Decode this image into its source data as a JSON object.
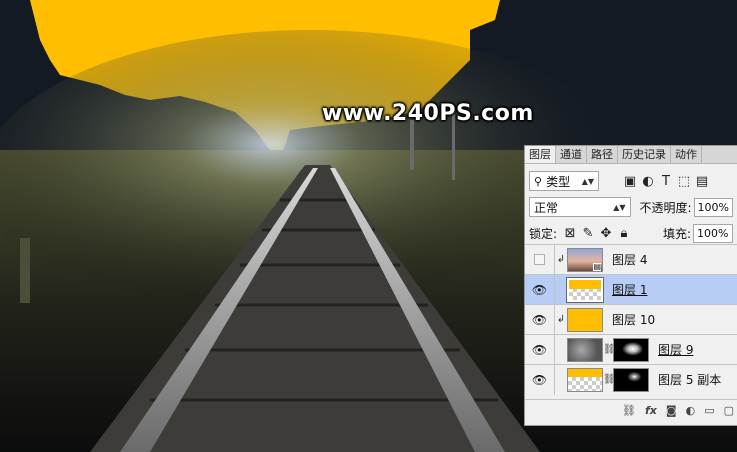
{
  "watermark": "www.240PS.com",
  "colors": {
    "fill": "#ffbe00",
    "selection": "#b8cdf5"
  },
  "panel": {
    "tabs": [
      "图层",
      "通道",
      "路径",
      "历史记录",
      "动作"
    ],
    "filter": {
      "label": "类型"
    },
    "blend_mode": "正常",
    "opacity": {
      "label": "不透明度:",
      "value": "100%"
    },
    "lock": {
      "label": "锁定:"
    },
    "fill": {
      "label": "填充:",
      "value": "100%"
    },
    "layers": [
      {
        "name": "图层 4",
        "visible": false,
        "clipped": true,
        "selected": false
      },
      {
        "name": "图层 1",
        "visible": true,
        "clipped": false,
        "selected": true
      },
      {
        "name": "图层 10",
        "visible": true,
        "clipped": true,
        "selected": false
      },
      {
        "name": "图层 9",
        "visible": true,
        "clipped": false,
        "selected": false
      },
      {
        "name": "图层 5 副本",
        "visible": true,
        "clipped": false,
        "selected": false
      }
    ],
    "bottom_icons": [
      "link-icon",
      "fx-icon",
      "mask-icon",
      "adjustment-icon",
      "group-folder-icon",
      "new-layer-icon"
    ]
  }
}
